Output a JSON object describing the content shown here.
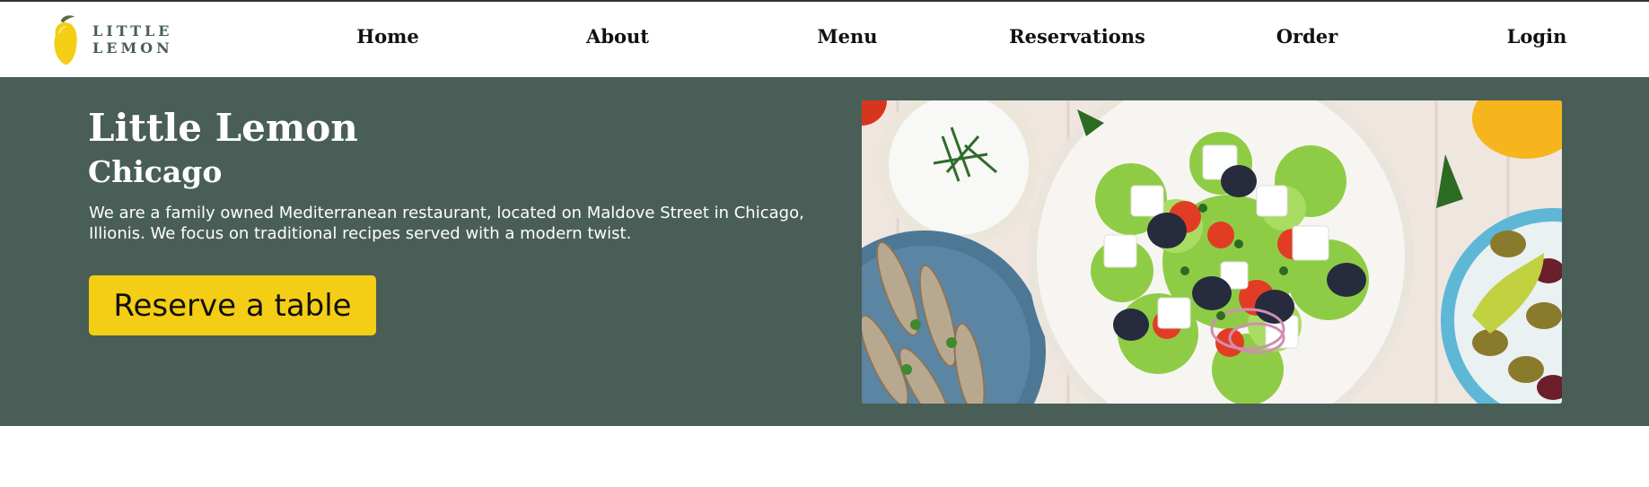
{
  "brand": {
    "logo_text": "LITTLE LEMON",
    "logo_icon": "lemon-icon",
    "primary_color": "#495e57",
    "accent_color": "#f4ce14"
  },
  "nav": {
    "items": [
      {
        "label": "Home"
      },
      {
        "label": "About"
      },
      {
        "label": "Menu"
      },
      {
        "label": "Reservations"
      },
      {
        "label": "Order"
      },
      {
        "label": "Login"
      }
    ]
  },
  "hero": {
    "title": "Little Lemon",
    "subtitle": "Chicago",
    "description": "We are a family owned Mediterranean restaurant, located on Maldove Street in Chicago, Illionis. We focus on traditional recipes served with a modern twist.",
    "cta_label": "Reserve a table",
    "image_alt": "Greek salad"
  }
}
